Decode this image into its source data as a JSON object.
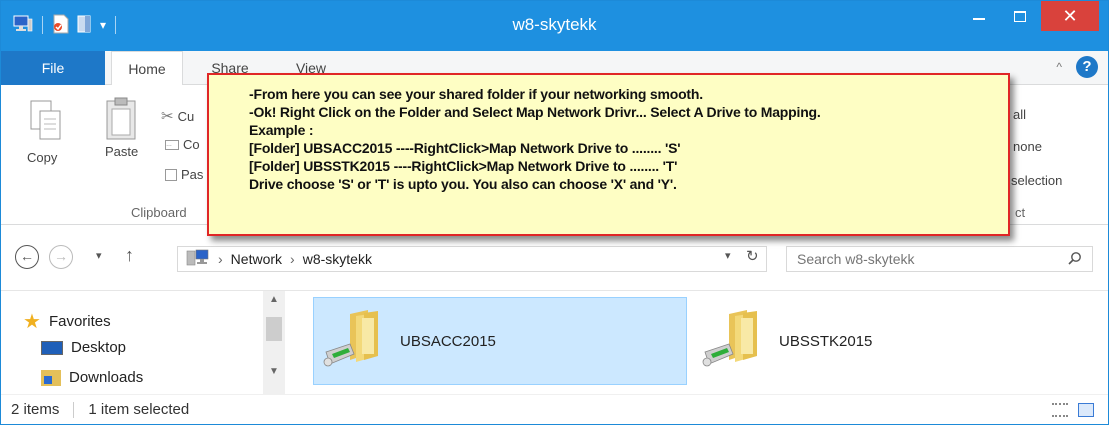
{
  "window": {
    "title": "w8-skytekk",
    "controls": {
      "minimize": "—",
      "maximize": "☐",
      "close": "✕"
    }
  },
  "tabs": [
    {
      "label": "File"
    },
    {
      "label": "Home"
    },
    {
      "label": "Share"
    },
    {
      "label": "View"
    }
  ],
  "ribbon": {
    "copy": "Copy",
    "paste": "Paste",
    "cut_partial": "Cu",
    "copypath_partial": "Co",
    "pasteshortcut_partial": "Pas",
    "clipboard_group": "Clipboard",
    "select_all_partial": "all",
    "select_none_partial": "none",
    "invert_selection_partial": "selection",
    "select_group_partial": "ct"
  },
  "navigation": {
    "back": "←",
    "forward": "→",
    "recent": "▾",
    "up": "↑",
    "breadcrumb": [
      "Network",
      "w8-skytekk"
    ],
    "breadcrumb_sep": "›",
    "dropdown": "▾",
    "refresh": "↻"
  },
  "search": {
    "placeholder": "Search w8-skytekk"
  },
  "navpane": {
    "items": [
      {
        "label": "Favorites",
        "icon": "star-icon"
      },
      {
        "label": "Desktop",
        "icon": "desktop-icon"
      },
      {
        "label": "Downloads",
        "icon": "downloads-icon"
      }
    ]
  },
  "folders": [
    {
      "name": "UBSACC2015",
      "selected": true
    },
    {
      "name": "UBSSTK2015",
      "selected": false
    }
  ],
  "status": {
    "items": "2 items",
    "selected": "1 item selected"
  },
  "callout": {
    "lines": [
      "-From here you can see your shared folder if your networking smooth.",
      "-Ok! Right Click on the Folder and Select Map Network Drivr... Select A Drive to Mapping.",
      "Example :",
      "[Folder] UBSACC2015 ----RightClick>Map Network Drive to ........ 'S'",
      "[Folder] UBSSTK2015 ----RightClick>Map Network Drive to ........ 'T'",
      "Drive choose 'S' or 'T' is upto you. You also can choose 'X' and 'Y'."
    ]
  },
  "colors": {
    "titlebar": "#1e90e0",
    "file_tab": "#1e78c8",
    "close_button": "#d9423c",
    "selection": "#cce8ff",
    "callout_bg": "#fefec4",
    "callout_border": "#e02626"
  }
}
